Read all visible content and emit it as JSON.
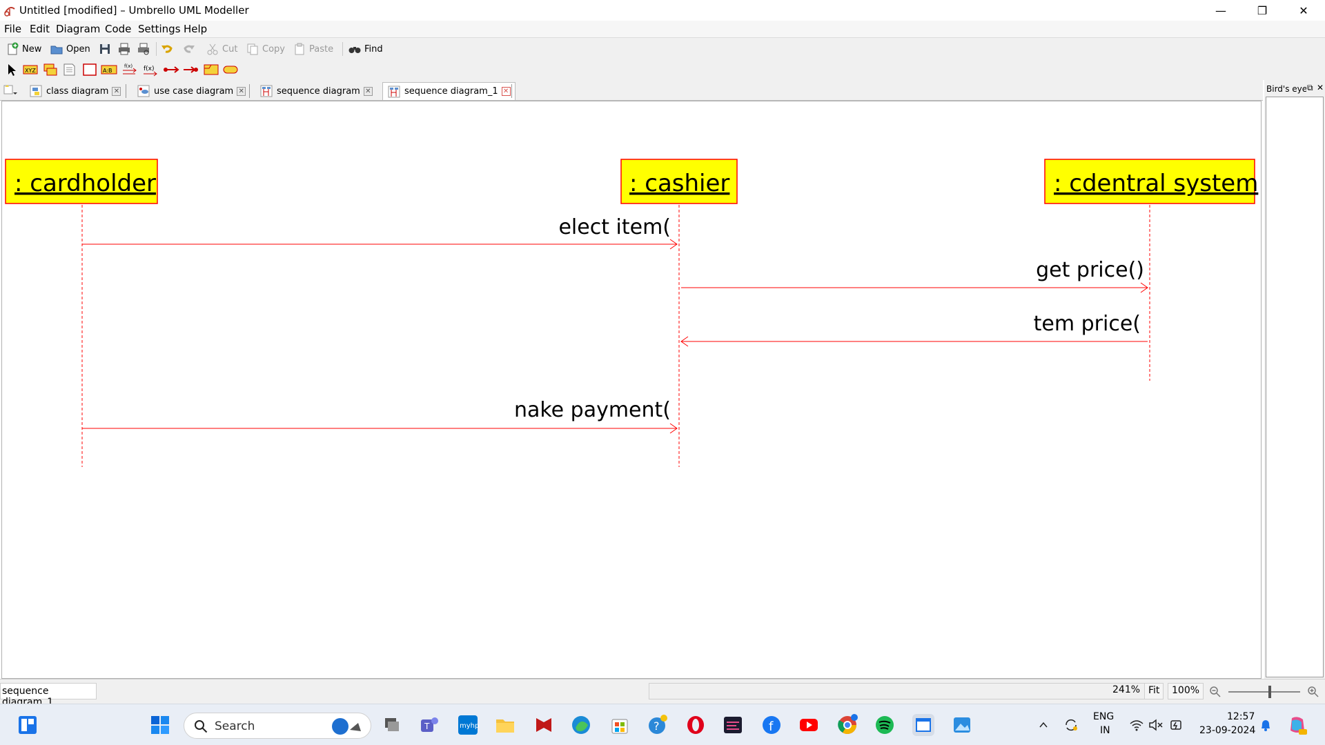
{
  "window": {
    "title": "Untitled [modified] – Umbrello UML Modeller"
  },
  "menu": [
    "File",
    "Edit",
    "Diagram",
    "Code",
    "Settings",
    "Help"
  ],
  "toolbar": {
    "new": "New",
    "open": "Open",
    "cut": "Cut",
    "copy": "Copy",
    "paste": "Paste",
    "find": "Find"
  },
  "tabs": [
    {
      "label": "class diagram",
      "active": false
    },
    {
      "label": "use case diagram",
      "active": false
    },
    {
      "label": "sequence diagram",
      "active": false
    },
    {
      "label": "sequence diagram_1",
      "active": true
    }
  ],
  "birdseye": {
    "title": "Bird's eye"
  },
  "diagram": {
    "objects": [
      ": cardholder",
      ": cashier",
      ": cdentral system"
    ],
    "messages": [
      "elect item(",
      "get price()",
      "tem price(",
      "nake payment("
    ],
    "color": "#ff0000",
    "object_fill": "#ffff00"
  },
  "status": {
    "diagram_name": "sequence diagram_1",
    "zoom": "241%",
    "fit": "Fit",
    "hundred": "100%"
  },
  "taskbar": {
    "search": "Search",
    "lang1": "ENG",
    "lang2": "IN",
    "time": "12:57",
    "date": "23-09-2024"
  }
}
